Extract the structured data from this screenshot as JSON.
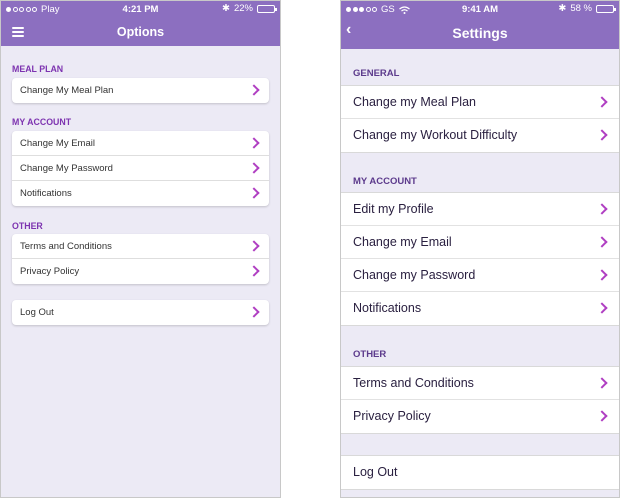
{
  "left": {
    "status": {
      "carrier": "Play",
      "time": "4:21 PM",
      "bluetooth": "✱",
      "battery": "22%",
      "battery_level": 0.22
    },
    "title": "Options",
    "sections": [
      {
        "title": "MEAL PLAN",
        "items": [
          {
            "label": "Change My Meal Plan"
          }
        ]
      },
      {
        "title": "MY ACCOUNT",
        "items": [
          {
            "label": "Change My Email"
          },
          {
            "label": "Change My Password"
          },
          {
            "label": "Notifications"
          }
        ]
      },
      {
        "title": "OTHER",
        "items": [
          {
            "label": "Terms and Conditions"
          },
          {
            "label": "Privacy Policy"
          }
        ]
      }
    ],
    "logout": "Log Out"
  },
  "right": {
    "status": {
      "carrier": "GS",
      "time": "9:41 AM",
      "bluetooth": "✱",
      "battery": "58 %",
      "battery_level": 0.58
    },
    "back": "‹",
    "title": "Settings",
    "sections": [
      {
        "title": "GENERAL",
        "items": [
          {
            "label": "Change my Meal Plan"
          },
          {
            "label": "Change my Workout Difficulty"
          }
        ]
      },
      {
        "title": "MY ACCOUNT",
        "items": [
          {
            "label": "Edit my Profile"
          },
          {
            "label": "Change my Email"
          },
          {
            "label": "Change my Password"
          },
          {
            "label": "Notifications"
          }
        ]
      },
      {
        "title": "OTHER",
        "items": [
          {
            "label": "Terms and Conditions"
          },
          {
            "label": "Privacy Policy"
          }
        ]
      }
    ],
    "logout": "Log Out"
  },
  "colors": {
    "header": "#8c6fc0",
    "accent": "#b03fc2",
    "section_left": "#7d33b0",
    "background": "#eceaf5"
  },
  "icons": {
    "menu": "hamburger-menu-icon",
    "back": "chevron-left-icon",
    "row": "chevron-right-icon",
    "wifi": "wifi-icon",
    "bluetooth": "bluetooth-icon"
  }
}
